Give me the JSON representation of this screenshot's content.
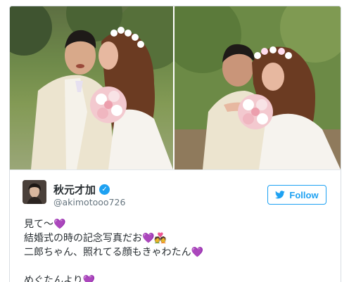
{
  "tweet": {
    "author": {
      "display_name": "秋元才加",
      "handle": "@akimotooo726",
      "verified": true
    },
    "follow_button": {
      "label": "Follow",
      "icon": "twitter-bird-icon"
    },
    "text_lines": [
      {
        "text": "見て〜",
        "suffix": "💜"
      },
      {
        "text": "結婚式の時の記念写真だお",
        "suffix": "💜💑"
      },
      {
        "text": "二郎ちゃん、照れてる顔もきゃわたん",
        "suffix": "💜"
      },
      {
        "text": "",
        "suffix": ""
      },
      {
        "text": "めぐたんより",
        "suffix": "💜"
      }
    ],
    "photos": [
      {
        "alt": "wedding photo left"
      },
      {
        "alt": "wedding photo right"
      }
    ]
  },
  "colors": {
    "accent": "#1da1f2",
    "text": "#292f33",
    "muted": "#66757f",
    "heart": "#b26ee8"
  }
}
